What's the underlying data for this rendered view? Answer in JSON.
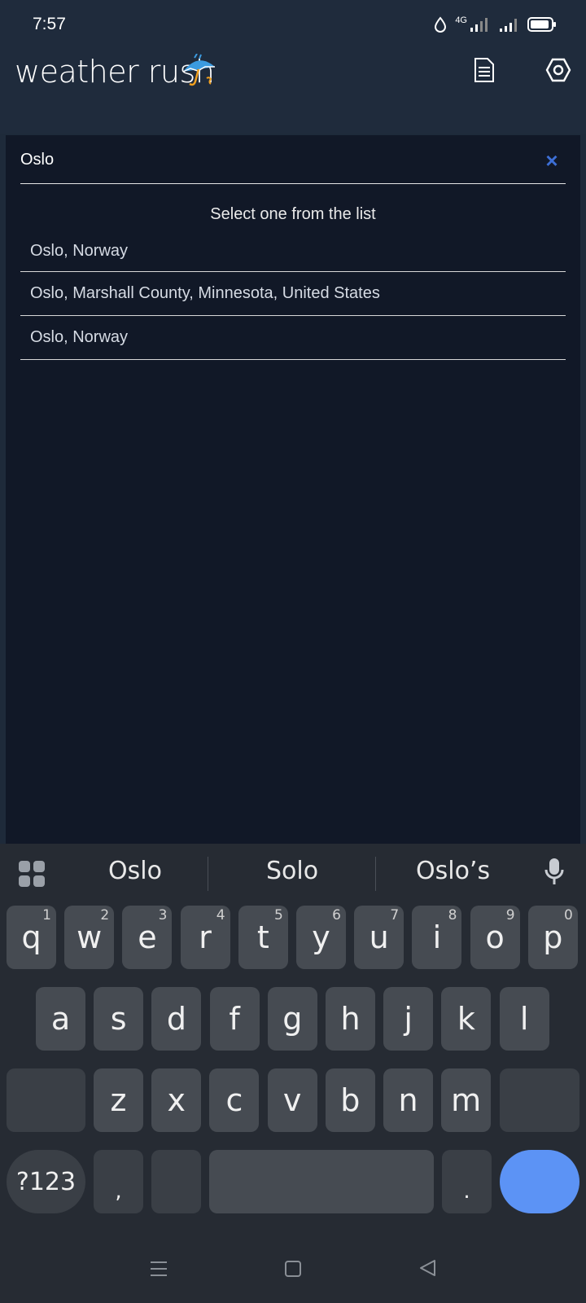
{
  "status": {
    "time": "7:57",
    "network": "4G"
  },
  "app": {
    "title": "weather rush"
  },
  "search": {
    "value": "Oslo",
    "clear_glyph": "×"
  },
  "list": {
    "hint": "Select one from the list",
    "items": [
      {
        "label": "Oslo, Norway"
      },
      {
        "label": "Oslo, Marshall County, Minnesota, United States"
      },
      {
        "label": "Oslo, Norway"
      }
    ]
  },
  "keyboard": {
    "suggestions": [
      "Oslo",
      "Solo",
      "Oslo’s"
    ],
    "row1": [
      {
        "k": "q",
        "h": "1"
      },
      {
        "k": "w",
        "h": "2"
      },
      {
        "k": "e",
        "h": "3"
      },
      {
        "k": "r",
        "h": "4"
      },
      {
        "k": "t",
        "h": "5"
      },
      {
        "k": "y",
        "h": "6"
      },
      {
        "k": "u",
        "h": "7"
      },
      {
        "k": "i",
        "h": "8"
      },
      {
        "k": "o",
        "h": "9"
      },
      {
        "k": "p",
        "h": "0"
      }
    ],
    "row2": [
      "a",
      "s",
      "d",
      "f",
      "g",
      "h",
      "j",
      "k",
      "l"
    ],
    "row3": [
      "z",
      "x",
      "c",
      "v",
      "b",
      "n",
      "m"
    ],
    "symbols_label": "?123",
    "comma_label": ",",
    "period_label": "."
  },
  "colors": {
    "background": "#1e2a3a",
    "panel": "#111827",
    "accent": "#3d6fd6",
    "search_key": "#5c93f5"
  }
}
